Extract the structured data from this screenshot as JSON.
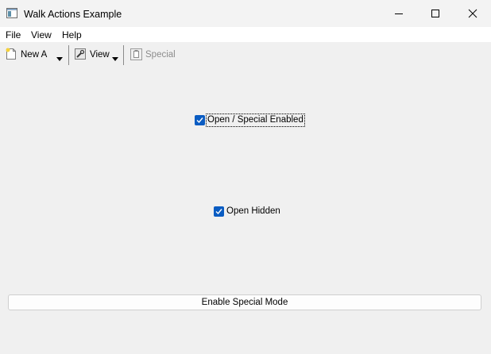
{
  "window": {
    "title": "Walk Actions Example"
  },
  "menu": {
    "items": [
      {
        "label": "File"
      },
      {
        "label": "View"
      },
      {
        "label": "Help"
      }
    ]
  },
  "toolbar": {
    "new_label": "New A",
    "view_label": "View",
    "special_label": "Special",
    "special_enabled": false
  },
  "checkboxes": {
    "open_special": {
      "label": "Open / Special Enabled",
      "checked": true
    },
    "open_hidden": {
      "label": "Open Hidden",
      "checked": true
    }
  },
  "button": {
    "label": "Enable Special Mode"
  },
  "icons": {
    "app": "app-window-icon",
    "new": "new-document-icon",
    "view": "view-tools-icon",
    "special": "special-document-icon"
  },
  "colors": {
    "accent": "#0a5cc2",
    "background": "#f0f0f0",
    "disabled_text": "#8c8c8c"
  }
}
